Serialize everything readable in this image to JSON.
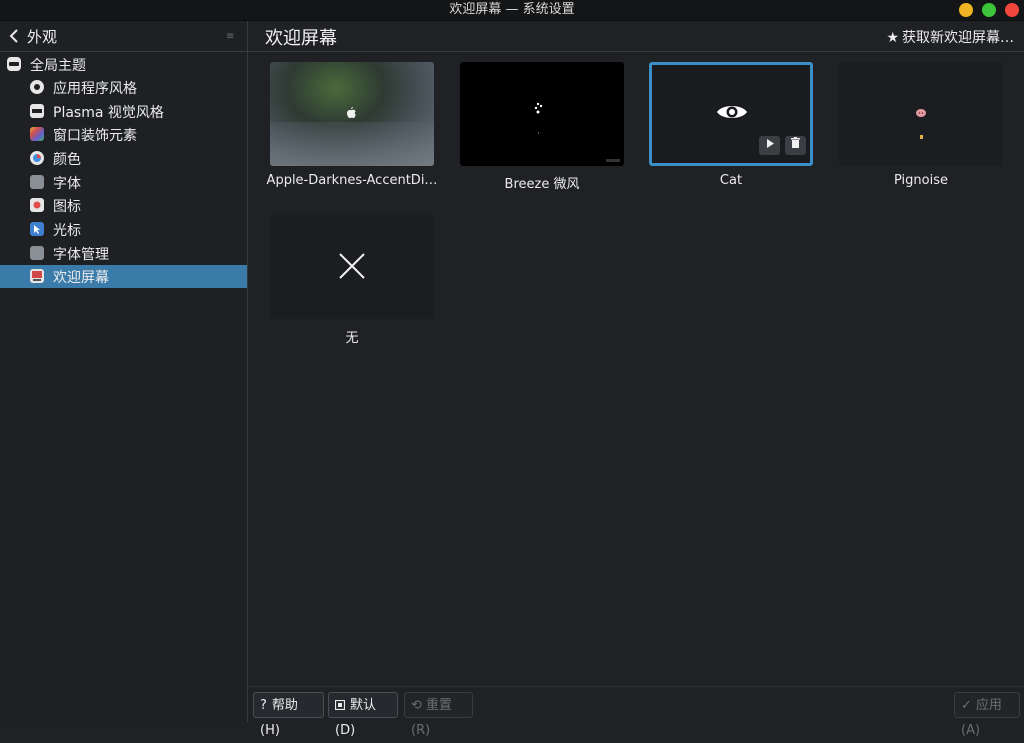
{
  "window": {
    "title": "欢迎屏幕 — 系统设置"
  },
  "sidebar": {
    "back_label": "外观",
    "items": [
      {
        "label": "全局主题",
        "icon": "global-theme-icon",
        "color": "#e6e6e6"
      },
      {
        "label": "应用程序风格",
        "icon": "app-style-icon",
        "color": "#e6e6e6"
      },
      {
        "label": "Plasma 视觉风格",
        "icon": "plasma-style-icon",
        "color": "#e6e6e6"
      },
      {
        "label": "窗口装饰元素",
        "icon": "window-decoration-icon",
        "color": "#d9a03a"
      },
      {
        "label": "颜色",
        "icon": "colors-icon",
        "color": "#3f8fe0"
      },
      {
        "label": "字体",
        "icon": "fonts-icon",
        "color": "#8a8f96"
      },
      {
        "label": "图标",
        "icon": "icons-icon",
        "color": "#e04a4a"
      },
      {
        "label": "光标",
        "icon": "cursor-icon",
        "color": "#3f7fd0"
      },
      {
        "label": "字体管理",
        "icon": "font-management-icon",
        "color": "#8a8f96"
      },
      {
        "label": "欢迎屏幕",
        "icon": "splash-screen-icon",
        "color": "#d04848",
        "selected": true
      }
    ]
  },
  "main": {
    "title": "欢迎屏幕",
    "get_new_label": "获取新欢迎屏幕…",
    "themes": [
      {
        "name": "Apple-Darknes-AccentDi…"
      },
      {
        "name": "Breeze 微风"
      },
      {
        "name": "Cat",
        "selected": true
      },
      {
        "name": "Pignoise"
      },
      {
        "name": "无"
      }
    ]
  },
  "footer": {
    "help": "帮助(H)",
    "defaults": "默认(D)",
    "reset": "重置(R)",
    "apply": "应用(A)"
  },
  "colors": {
    "accent": "#3a7ba9",
    "selection_border": "#3a8fc7"
  }
}
